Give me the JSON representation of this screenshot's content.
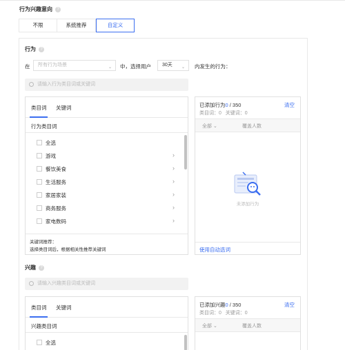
{
  "behavior_direction": {
    "title": "行为兴趣意向",
    "options": [
      "不限",
      "系统推荐",
      "自定义"
    ],
    "active_index": 2
  },
  "behavior": {
    "section_title": "行为",
    "in_label": "在",
    "scene_placeholder": "所有行为场景",
    "middle_label": "中，选择用户",
    "days_value": "30天",
    "after_label": "内发生的行为：",
    "search_placeholder": "请输入行为类目词或关键词",
    "tabs": [
      "类目词",
      "关键词"
    ],
    "list_header": "行为类目词",
    "items": [
      {
        "label": "全选",
        "has_children": false
      },
      {
        "label": "游戏",
        "has_children": true
      },
      {
        "label": "餐饮美食",
        "has_children": true
      },
      {
        "label": "生活服务",
        "has_children": true
      },
      {
        "label": "家居家装",
        "has_children": true
      },
      {
        "label": "商务服务",
        "has_children": true
      },
      {
        "label": "家电数码",
        "has_children": true
      }
    ],
    "recommend_title": "关键词推荐：",
    "recommend_desc": "选择类目词后，根据相关性推荐关键词",
    "added_label": "已添加行为",
    "added_count": "0",
    "added_max": "/ 350",
    "clear_label": "清空",
    "category_count": "类目词：0",
    "keyword_count": "关键词：0",
    "filter_all": "全部",
    "coverage_label": "覆盖人数",
    "empty_text": "未添加行为",
    "auto_expand_label": "使用自动选词"
  },
  "interest": {
    "section_title": "兴趣",
    "search_placeholder": "请输入兴趣类目词或关键词",
    "tabs": [
      "类目词",
      "关键词"
    ],
    "list_header": "兴趣类目词",
    "items": [
      {
        "label": "全选",
        "has_children": false
      }
    ],
    "added_label": "已添加兴趣",
    "added_count": "0",
    "added_max": "/ 350",
    "clear_label": "清空",
    "category_count": "类目词：0",
    "keyword_count": "关键词：0",
    "filter_all": "全部",
    "coverage_label": "覆盖人数"
  },
  "colors": {
    "accent": "#3a6df0",
    "border": "#e0e0e0"
  }
}
